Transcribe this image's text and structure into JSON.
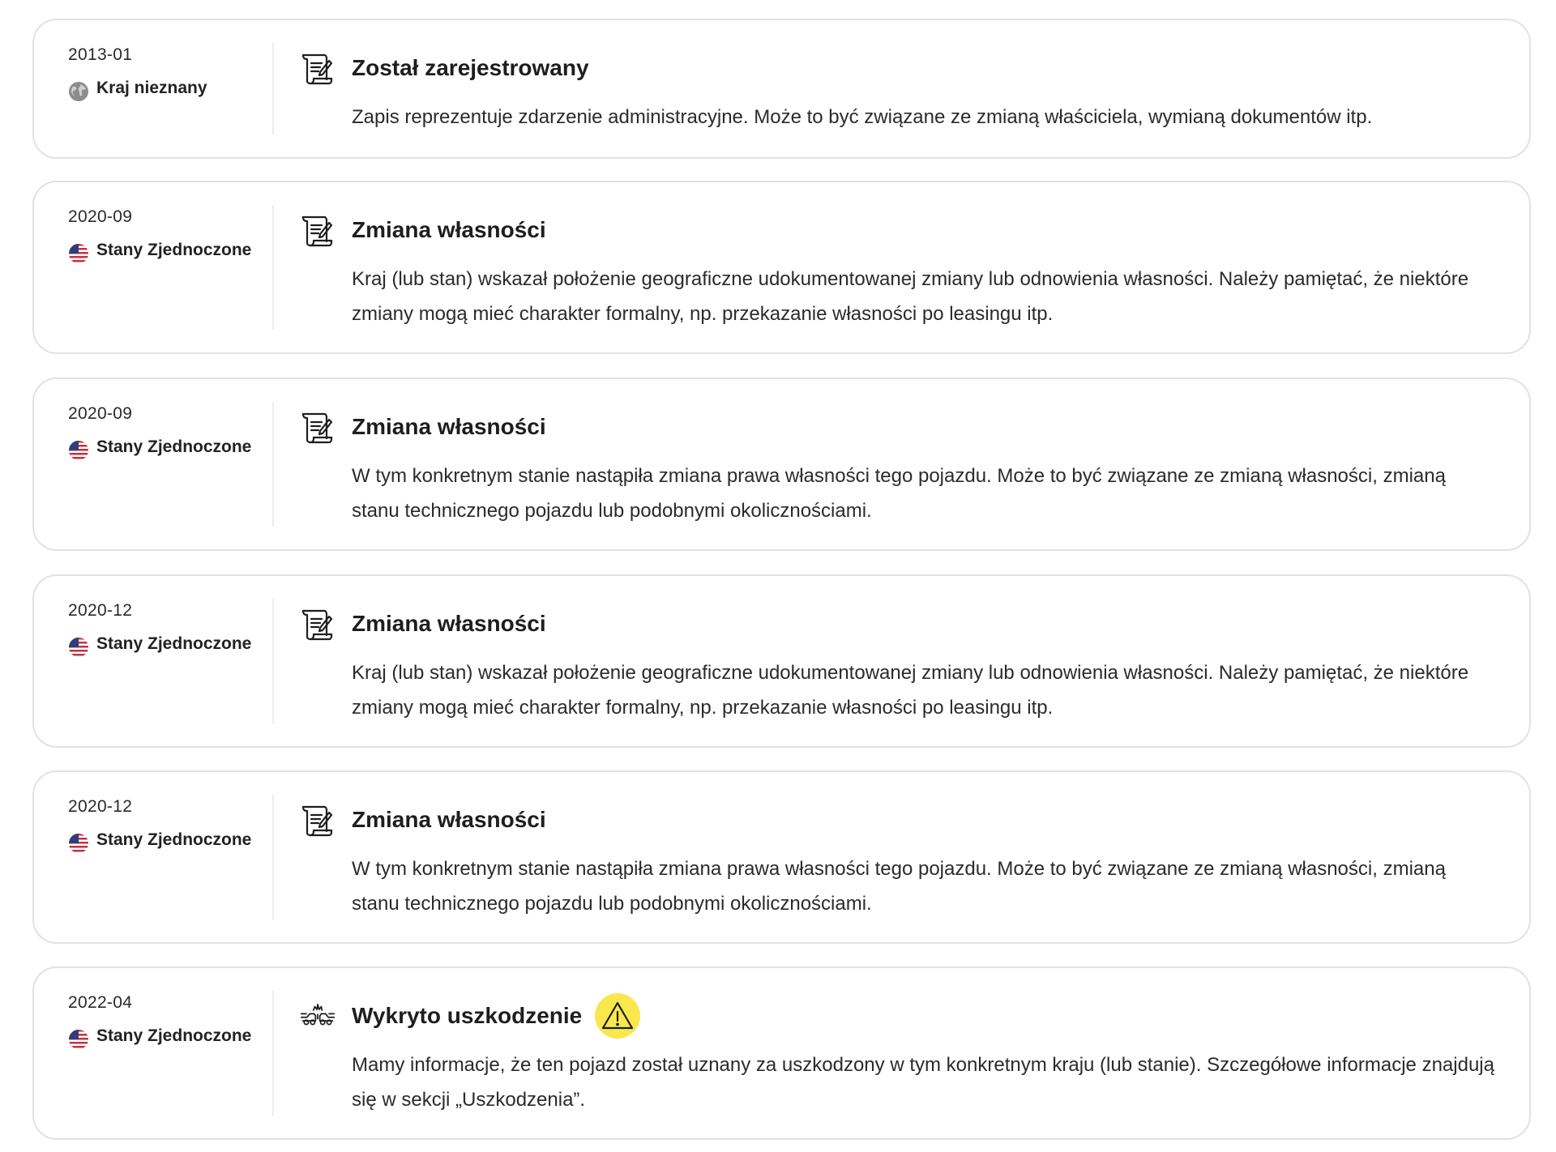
{
  "events": [
    {
      "date": "2013-01",
      "country": "Kraj nieznany",
      "country_icon": "globe-icon",
      "event_icon": "document-scroll-icon",
      "title": "Został zarejestrowany",
      "description": "Zapis reprezentuje zdarzenie administracyjne. Może to być związane ze zmianą właściciela, wymianą dokumentów itp."
    },
    {
      "date": "2020-09",
      "country": "Stany Zjednoczone",
      "country_icon": "us-flag-icon",
      "event_icon": "document-scroll-icon",
      "title": "Zmiana własności",
      "description": "Kraj (lub stan) wskazał położenie geograficzne udokumentowanej zmiany lub odnowienia własności. Należy pamiętać, że niektóre zmiany mogą mieć charakter formalny, np. przekazanie własności po leasingu itp."
    },
    {
      "date": "2020-09",
      "country": "Stany Zjednoczone",
      "country_icon": "us-flag-icon",
      "event_icon": "document-scroll-icon",
      "title": "Zmiana własności",
      "description": "W tym konkretnym stanie nastąpiła zmiana prawa własności tego pojazdu. Może to być związane ze zmianą własności, zmianą stanu technicznego pojazdu lub podobnymi okolicznościami."
    },
    {
      "date": "2020-12",
      "country": "Stany Zjednoczone",
      "country_icon": "us-flag-icon",
      "event_icon": "document-scroll-icon",
      "title": "Zmiana własności",
      "description": "Kraj (lub stan) wskazał położenie geograficzne udokumentowanej zmiany lub odnowienia własności. Należy pamiętać, że niektóre zmiany mogą mieć charakter formalny, np. przekazanie własności po leasingu itp."
    },
    {
      "date": "2020-12",
      "country": "Stany Zjednoczone",
      "country_icon": "us-flag-icon",
      "event_icon": "document-scroll-icon",
      "title": "Zmiana własności",
      "description": "W tym konkretnym stanie nastąpiła zmiana prawa własności tego pojazdu. Może to być związane ze zmianą własności, zmianą stanu technicznego pojazdu lub podobnymi okolicznościami."
    },
    {
      "date": "2022-04",
      "country": "Stany Zjednoczone",
      "country_icon": "us-flag-icon",
      "event_icon": "car-crash-icon",
      "title": "Wykryto uszkodzenie",
      "warning_icon": "warning-triangle-icon",
      "description": "Mamy informacje, że ten pojazd został uznany za uszkodzony w tym konkretnym kraju (lub stanie). Szczegółowe informacje znajdują się w sekcji „Uszkodzenia”."
    }
  ],
  "colors": {
    "card_border": "#e2e2e2",
    "warning_badge": "#f8e84e",
    "text": "#1c1c1c"
  }
}
